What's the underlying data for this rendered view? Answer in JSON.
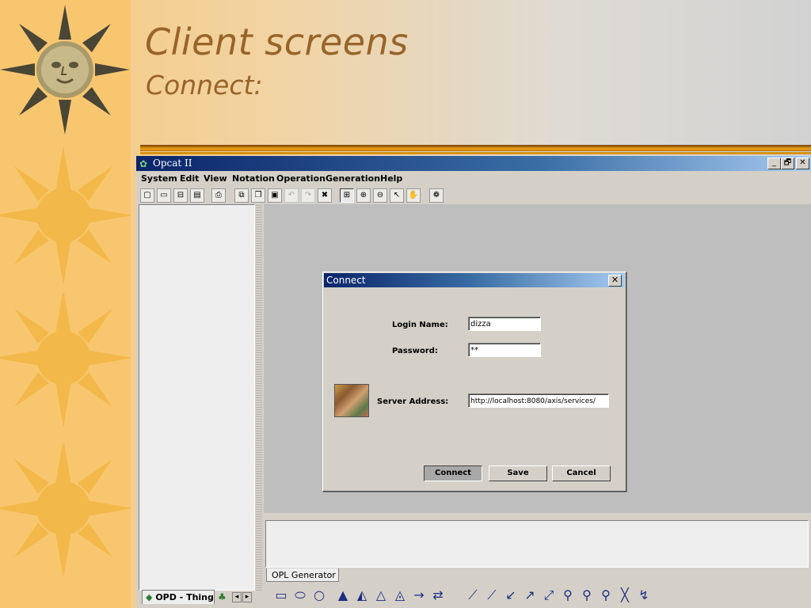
{
  "slide": {
    "title": "Client screens",
    "subtitle": "Connect:"
  },
  "window": {
    "title": "Opcat II",
    "controls": [
      "_",
      "🗗",
      "✕"
    ]
  },
  "menu": [
    "System",
    "Edit",
    "View",
    "Notation",
    "Operation",
    "Generation",
    "Help"
  ],
  "toolbar_icons": [
    "new-icon",
    "open-icon",
    "save-as-icon",
    "save-icon",
    "print-icon",
    "cut-icon",
    "copy-icon",
    "paste-icon",
    "undo-icon",
    "redo-icon",
    "delete-icon",
    "fit-icon",
    "zoom-in-icon",
    "zoom-out-icon",
    "pointer-icon",
    "hand-icon",
    "animation-icon"
  ],
  "left_panel": {
    "tab_label": "OPD - Thing"
  },
  "opl": {
    "tab_label": "OPL Generator"
  },
  "dialog": {
    "title": "Connect",
    "login_label": "Login Name:",
    "login_value": "dizza",
    "password_label": "Password:",
    "password_value": "**",
    "server_label": "Server Address:",
    "server_value": "http://localhost:8080/axis/services/",
    "buttons": {
      "connect": "Connect",
      "save": "Save",
      "cancel": "Cancel"
    }
  },
  "colors": {
    "title_text": "#98642a",
    "sidebar": "#f9c670",
    "sun": "#f2b94a",
    "titlebar": "#0a246a"
  }
}
